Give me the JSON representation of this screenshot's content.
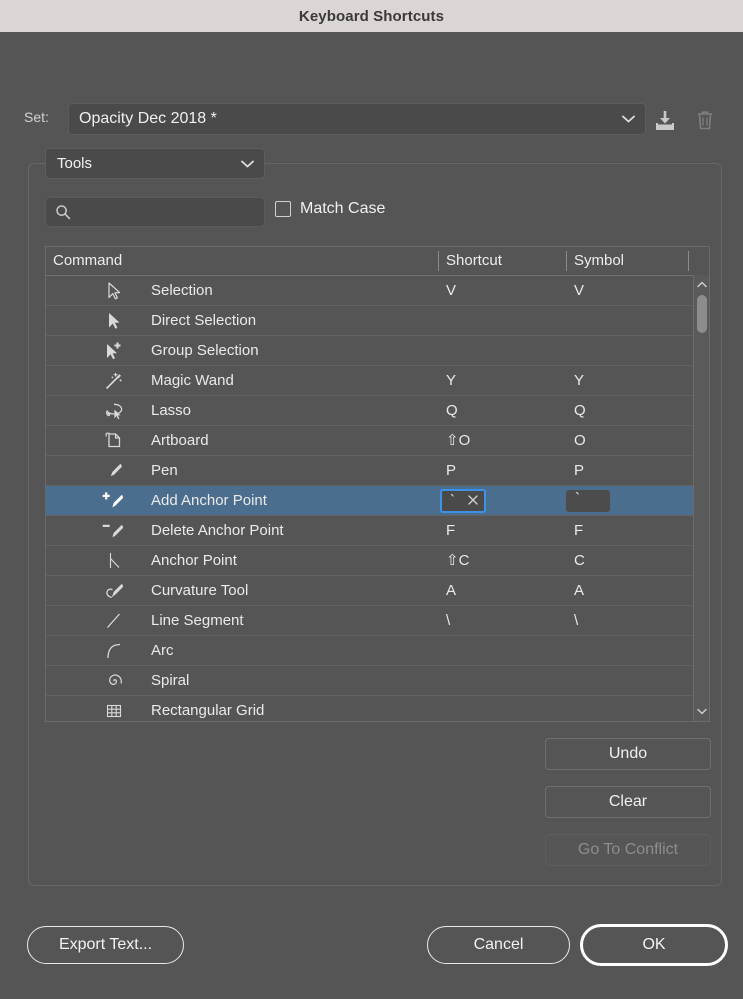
{
  "window": {
    "title": "Keyboard Shortcuts"
  },
  "set_row": {
    "label": "Set:",
    "value": "Opacity Dec 2018 *",
    "dropdown_icon": "chevron-down-icon",
    "save_icon": "save-to-disk-icon",
    "delete_icon": "trash-icon"
  },
  "category": {
    "value": "Tools",
    "dropdown_icon": "chevron-down-icon"
  },
  "search": {
    "value": "",
    "placeholder": "",
    "icon": "search-icon"
  },
  "match_case": {
    "label": "Match Case",
    "checked": false
  },
  "table": {
    "columns": [
      "Command",
      "Shortcut",
      "Symbol"
    ],
    "rows": [
      {
        "icon": "selection-arrow-icon",
        "command": "Selection",
        "shortcut": "V",
        "symbol": "V",
        "selected": false
      },
      {
        "icon": "direct-selection-arrow-icon",
        "command": "Direct Selection",
        "shortcut": "",
        "symbol": "",
        "selected": false
      },
      {
        "icon": "group-selection-arrow-icon",
        "command": "Group Selection",
        "shortcut": "",
        "symbol": "",
        "selected": false
      },
      {
        "icon": "magic-wand-icon",
        "command": "Magic Wand",
        "shortcut": "Y",
        "symbol": "Y",
        "selected": false
      },
      {
        "icon": "lasso-icon",
        "command": "Lasso",
        "shortcut": "Q",
        "symbol": "Q",
        "selected": false
      },
      {
        "icon": "artboard-icon",
        "command": "Artboard",
        "shortcut": "⇧O",
        "symbol": "O",
        "selected": false
      },
      {
        "icon": "pen-icon",
        "command": "Pen",
        "shortcut": "P",
        "symbol": "P",
        "selected": false
      },
      {
        "icon": "add-anchor-point-icon",
        "command": "Add Anchor Point",
        "shortcut": "`",
        "symbol": "`",
        "selected": true
      },
      {
        "icon": "delete-anchor-point-icon",
        "command": "Delete Anchor Point",
        "shortcut": "F",
        "symbol": "F",
        "selected": false
      },
      {
        "icon": "anchor-point-icon",
        "command": "Anchor Point",
        "shortcut": "⇧C",
        "symbol": "C",
        "selected": false
      },
      {
        "icon": "curvature-tool-icon",
        "command": "Curvature Tool",
        "shortcut": "A",
        "symbol": "A",
        "selected": false
      },
      {
        "icon": "line-segment-icon",
        "command": "Line Segment",
        "shortcut": "\\",
        "symbol": "\\",
        "selected": false
      },
      {
        "icon": "arc-icon",
        "command": "Arc",
        "shortcut": "",
        "symbol": "",
        "selected": false
      },
      {
        "icon": "spiral-icon",
        "command": "Spiral",
        "shortcut": "",
        "symbol": "",
        "selected": false
      },
      {
        "icon": "rectangular-grid-icon",
        "command": "Rectangular Grid",
        "shortcut": "",
        "symbol": "",
        "selected": false
      }
    ],
    "selected_row_index": 7,
    "selected_shortcut_value": "`",
    "selected_symbol_value": "`",
    "clear_icon": "clear-x-icon",
    "scrollbar": {
      "up_icon": "chevron-up-icon",
      "down_icon": "chevron-down-icon"
    }
  },
  "side_buttons": {
    "undo": "Undo",
    "clear": "Clear",
    "go_to_conflict": "Go To Conflict",
    "go_to_conflict_disabled": true
  },
  "bottom_buttons": {
    "export": "Export Text...",
    "cancel": "Cancel",
    "ok": "OK"
  },
  "colors": {
    "dialog_bg": "#555555",
    "titlebar_bg": "#dbd5d3",
    "selection_blue": "#4c6e8e",
    "focus_blue": "#3d92e8",
    "text": "#eaeaea",
    "disabled_text": "#8d8d8d"
  }
}
